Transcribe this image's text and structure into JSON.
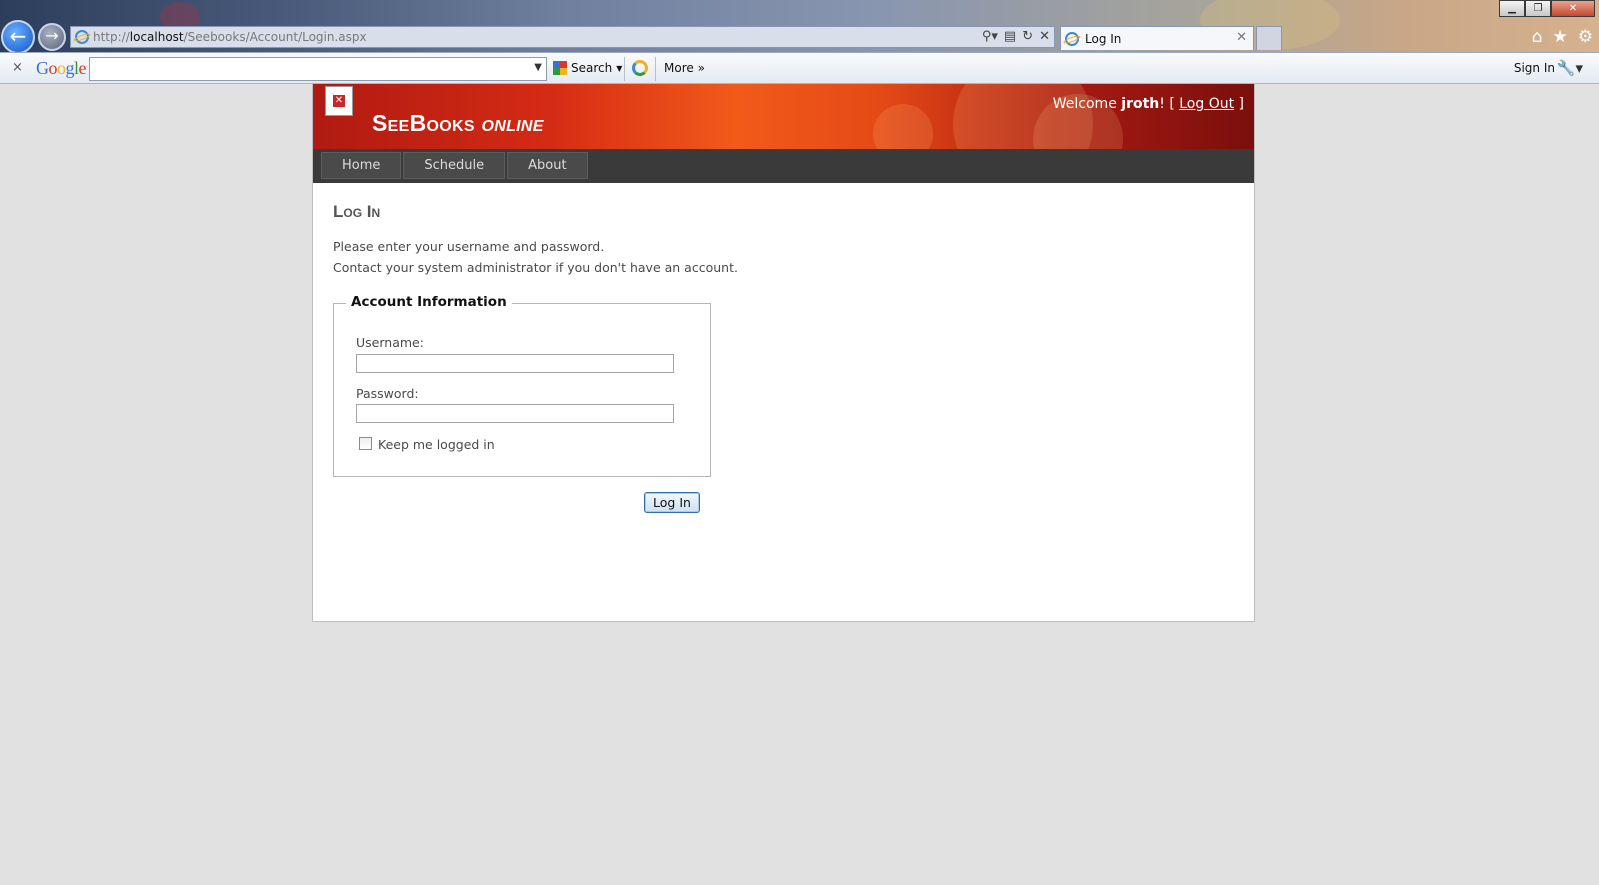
{
  "browser": {
    "window_controls": {
      "minimize": "▁",
      "restore": "❐",
      "close": "✕"
    },
    "back_glyph": "←",
    "forward_glyph": "→",
    "address": {
      "prefix": "http://",
      "host": "localhost",
      "path": "/Seebooks/Account/Login.aspx"
    },
    "tab": {
      "label": "Log In"
    },
    "toolbar": {
      "close_glyph": "×",
      "google_logo": [
        "G",
        "o",
        "o",
        "g",
        "l",
        "e"
      ],
      "search_value": "",
      "search_label": "Search",
      "more_label": "More »",
      "signin_label": "Sign In"
    },
    "right_icons": {
      "home": "⌂",
      "favorites": "★",
      "tools": "⚙"
    }
  },
  "site": {
    "title_main": "SeeBooks",
    "title_sub": " online",
    "welcome_prefix": "Welcome ",
    "username": "jroth",
    "welcome_suffix": "! [ ",
    "logout_label": "Log Out",
    "close_bracket": " ]",
    "menu": [
      {
        "label": "Home"
      },
      {
        "label": "Schedule"
      },
      {
        "label": "About"
      }
    ]
  },
  "login": {
    "heading": "Log In",
    "intro_line1": "Please enter your username and password.",
    "intro_line2": "Contact your system administrator if you don't have an account.",
    "legend": "Account Information",
    "username_label": "Username:",
    "username_value": "",
    "password_label": "Password:",
    "password_value": "",
    "remember_label": "Keep me logged in",
    "remember_checked": false,
    "submit_label": "Log In"
  },
  "colors": {
    "header_red": "#d42b14",
    "header_orange": "#f25a1a",
    "menu_bg": "#3a3a3a",
    "page_bg": "#e1e1e1",
    "button_border": "#2f6fa5"
  }
}
